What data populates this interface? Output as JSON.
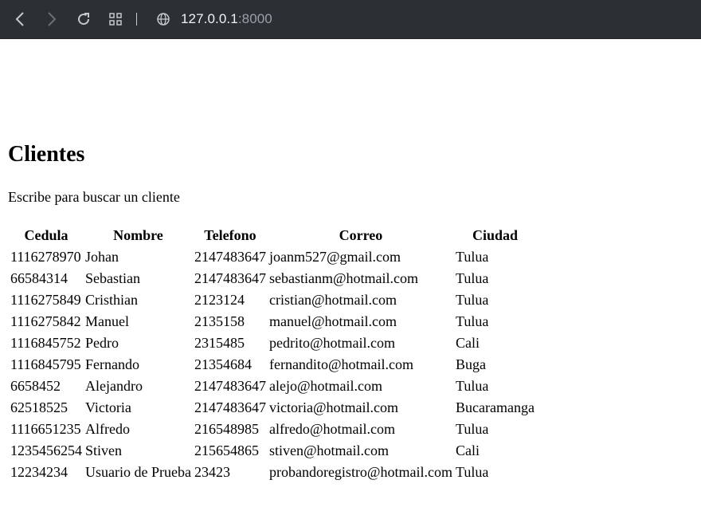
{
  "browser": {
    "url_host": "127.0.0.1",
    "url_port": ":8000"
  },
  "page": {
    "title": "Clientes",
    "hint": "Escribe para buscar un cliente"
  },
  "table": {
    "headers": [
      "Cedula",
      "Nombre",
      "Telefono",
      "Correo",
      "Ciudad"
    ],
    "rows": [
      [
        "1116278970",
        "Johan",
        "2147483647",
        "joanm527@gmail.com",
        "Tulua"
      ],
      [
        "66584314",
        "Sebastian",
        "2147483647",
        "sebastianm@hotmail.com",
        "Tulua"
      ],
      [
        "1116275849",
        "Cristhian",
        "2123124",
        "cristian@hotmail.com",
        "Tulua"
      ],
      [
        "1116275842",
        "Manuel",
        "2135158",
        "manuel@hotmail.com",
        "Tulua"
      ],
      [
        "1116845752",
        "Pedro",
        "2315485",
        "pedrito@hotmail.com",
        "Cali"
      ],
      [
        "1116845795",
        "Fernando",
        "21354684",
        "fernandito@hotmail.com",
        "Buga"
      ],
      [
        "6658452",
        "Alejandro",
        "2147483647",
        "alejo@hotmail.com",
        "Tulua"
      ],
      [
        "62518525",
        "Victoria",
        "2147483647",
        "victoria@hotmail.com",
        "Bucaramanga"
      ],
      [
        "1116651235",
        "Alfredo",
        "216548985",
        "alfredo@hotmail.com",
        "Tulua"
      ],
      [
        "1235456254",
        "Stiven",
        "215654865",
        "stiven@hotmail.com",
        "Cali"
      ],
      [
        "12234234",
        "Usuario de Prueba",
        "23423",
        "probandoregistro@hotmail.com",
        "Tulua"
      ]
    ]
  }
}
